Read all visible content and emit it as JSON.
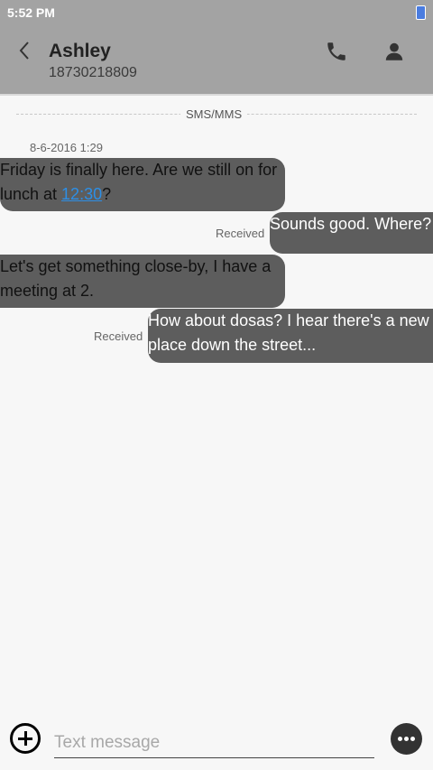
{
  "status_bar": {
    "time": "5:52 PM"
  },
  "header": {
    "contact_name": "Ashley",
    "contact_number": "18730218809"
  },
  "conversation": {
    "channel_label": "SMS/MMS",
    "date": "8-6-2016 1:29",
    "messages": [
      {
        "direction": "incoming",
        "text_before_link": "Friday is finally here. Are we still on for lunch at ",
        "link": "12:30",
        "text_after_link": "?"
      },
      {
        "direction": "outgoing",
        "status": "Received",
        "text": "Sounds good. Where?"
      },
      {
        "direction": "incoming",
        "text": "Let's get something close-by, I have a meeting at 2."
      },
      {
        "direction": "outgoing",
        "status": "Received",
        "text": "How about dosas? I hear there's a new place down the street..."
      }
    ]
  },
  "composer": {
    "placeholder": "Text message"
  },
  "colors": {
    "header_bg": "#a3a3a3",
    "bubble_bg": "#5d5d5d",
    "link": "#2d8fe6",
    "page_bg": "#f7f7f7"
  },
  "icons": [
    "back-arrow-icon",
    "phone-icon",
    "person-icon",
    "add-icon",
    "more-icon",
    "battery-icon"
  ]
}
